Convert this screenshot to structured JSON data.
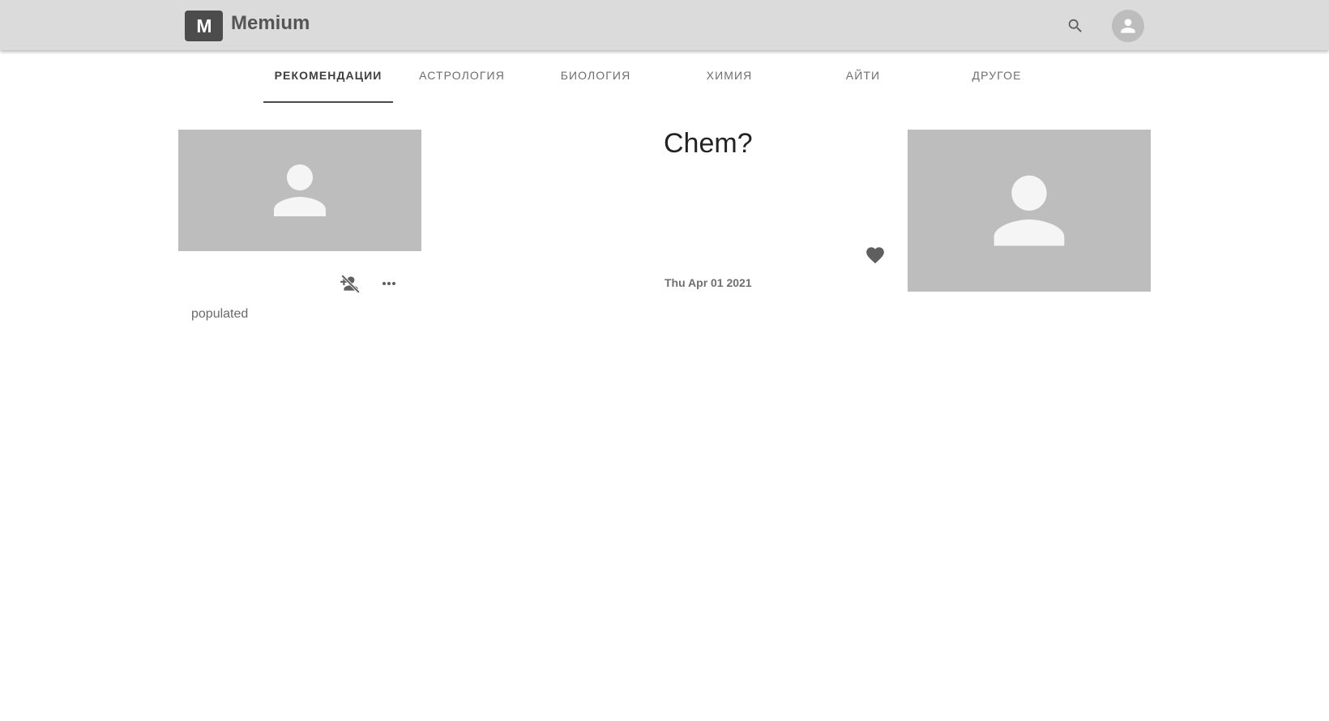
{
  "header": {
    "logo_letter": "M",
    "app_name": "Memium"
  },
  "tabs": [
    {
      "label": "Рекомендации",
      "active": true
    },
    {
      "label": "Астрология",
      "active": false
    },
    {
      "label": "Биология",
      "active": false
    },
    {
      "label": "Химия",
      "active": false
    },
    {
      "label": "Айти",
      "active": false
    },
    {
      "label": "Другое",
      "active": false
    }
  ],
  "profile_card": {
    "status": "populated",
    "icons": [
      "person-placeholder-icon",
      "unfollow-icon",
      "more-horizontal-icon"
    ]
  },
  "post": {
    "title": "Chem?",
    "date": "Thu Apr 01 2021",
    "icons": [
      "heart-icon",
      "person-placeholder-icon"
    ]
  },
  "icons": {
    "header": [
      "search-icon",
      "account-icon"
    ]
  },
  "colors": {
    "appbar": "#dcdbdc",
    "logo_box": "#4c4c4c",
    "placeholder": "#bdbdbd",
    "active_tab": "#3f3f3f"
  }
}
